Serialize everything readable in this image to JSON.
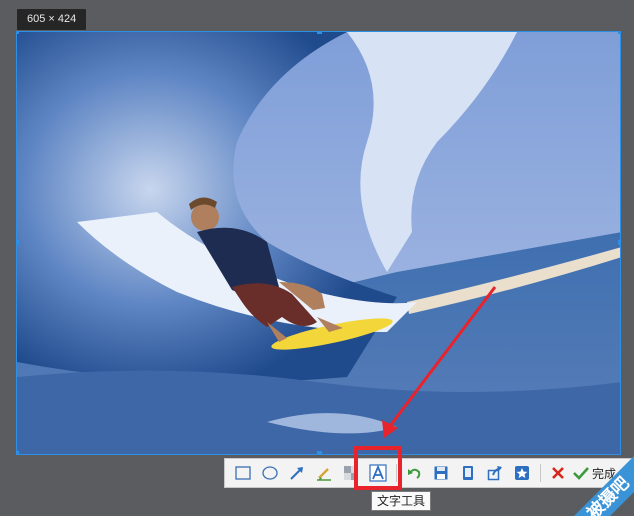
{
  "selection": {
    "size_label": "605 × 424"
  },
  "toolbar": {
    "tools": [
      {
        "icon": "rectangle-icon"
      },
      {
        "icon": "ellipse-icon"
      },
      {
        "icon": "arrow-icon"
      },
      {
        "icon": "brush-icon"
      },
      {
        "icon": "mosaic-icon"
      },
      {
        "icon": "text-tool-icon",
        "tooltip": "文字工具"
      },
      {
        "icon": "undo-icon"
      },
      {
        "icon": "save-icon"
      },
      {
        "icon": "pin-icon"
      },
      {
        "icon": "share-icon"
      },
      {
        "icon": "favorite-icon"
      },
      {
        "icon": "cancel-icon"
      }
    ],
    "done_label": "完成"
  },
  "tooltip_text": "文字工具",
  "watermark_text": "被摄吧",
  "colors": {
    "accent": "#2e8fe6",
    "highlight": "#e8232b",
    "annotation_arrow": "#e8232b"
  }
}
